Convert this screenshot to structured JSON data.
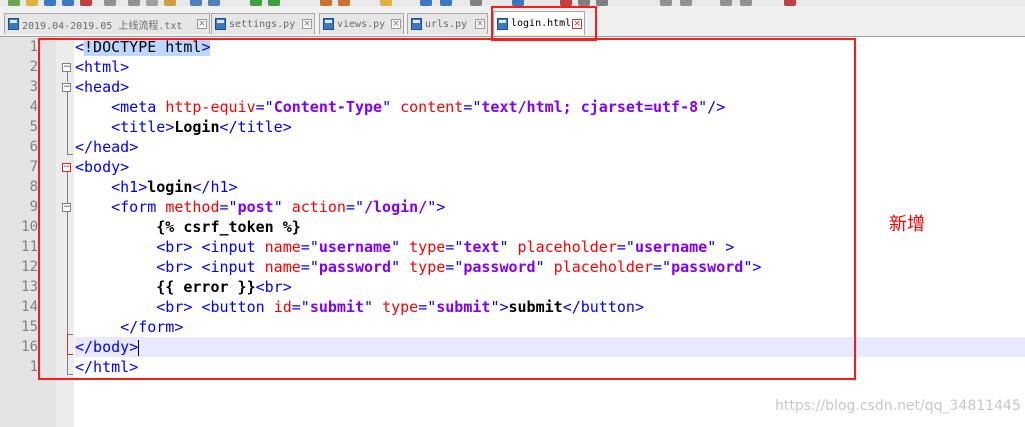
{
  "tabs": [
    {
      "label": "2019.04-2019.05 上线流程.txt",
      "active": false,
      "icon": "file-icon"
    },
    {
      "label": "settings.py",
      "active": false,
      "icon": "file-icon"
    },
    {
      "label": "views.py",
      "active": false,
      "icon": "file-icon"
    },
    {
      "label": "urls.py",
      "active": false,
      "icon": "file-icon"
    },
    {
      "label": "login.html",
      "active": true,
      "icon": "file-icon"
    }
  ],
  "line_numbers": [
    "1",
    "2",
    "3",
    "4",
    "5",
    "6",
    "7",
    "8",
    "9",
    "10",
    "11",
    "12",
    "13",
    "14",
    "15",
    "16",
    "1"
  ],
  "code_lines": [
    "<!DOCTYPE html>",
    "<html>",
    "<head>",
    "    <meta http-equiv=\"Content-Type\" content=\"text/html; cjarset=utf-8\"/>",
    "    <title>Login</title>",
    "</head>",
    "<body>",
    "    <h1>login</h1>",
    "    <form method=\"post\" action=\"/login/\">",
    "         {% csrf_token %}",
    "         <br> <input name=\"username\" type=\"text\" placeholder=\"username\" >",
    "         <br> <input name=\"password\" type=\"password\" placeholder=\"password\">",
    "         {{ error }}<br>",
    "         <br> <button id=\"submit\" type=\"submit\">submit</button>",
    "     </form>",
    "</body>",
    "</html>"
  ],
  "current_line": 16,
  "annotation": "新增",
  "watermark": "https://blog.csdn.net/qq_34811445",
  "colors": {
    "tag": "#0000ff",
    "attribute": "#ff0000",
    "value": "#8000ff",
    "highlight_border": "#ff1a1a",
    "annotation": "#ff0000"
  }
}
